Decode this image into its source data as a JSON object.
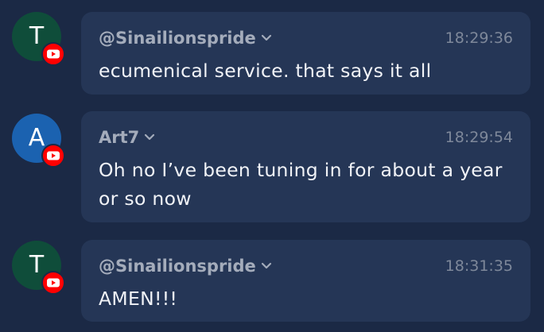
{
  "messages": [
    {
      "avatar_letter": "T",
      "avatar_color": "#0f4d3a",
      "badge_icon": "youtube-icon",
      "author": "@Sinailionspride",
      "time": "18:29:36",
      "text": "ecumenical service. that says it all"
    },
    {
      "avatar_letter": "A",
      "avatar_color": "#1b62b0",
      "badge_icon": "youtube-icon",
      "author": "Art7",
      "time": "18:29:54",
      "text": "Oh no I’ve been tuning in for about a year or so now"
    },
    {
      "avatar_letter": "T",
      "avatar_color": "#0f4d3a",
      "badge_icon": "youtube-icon",
      "author": "@Sinailionspride",
      "time": "18:31:35",
      "text": "AMEN!!!"
    }
  ],
  "colors": {
    "background": "#1b2945",
    "bubble": "#253656",
    "author_text": "#a4acbb",
    "time_text": "#7e889a",
    "message_text": "#f1f3f7",
    "youtube_red": "#ff0000"
  }
}
